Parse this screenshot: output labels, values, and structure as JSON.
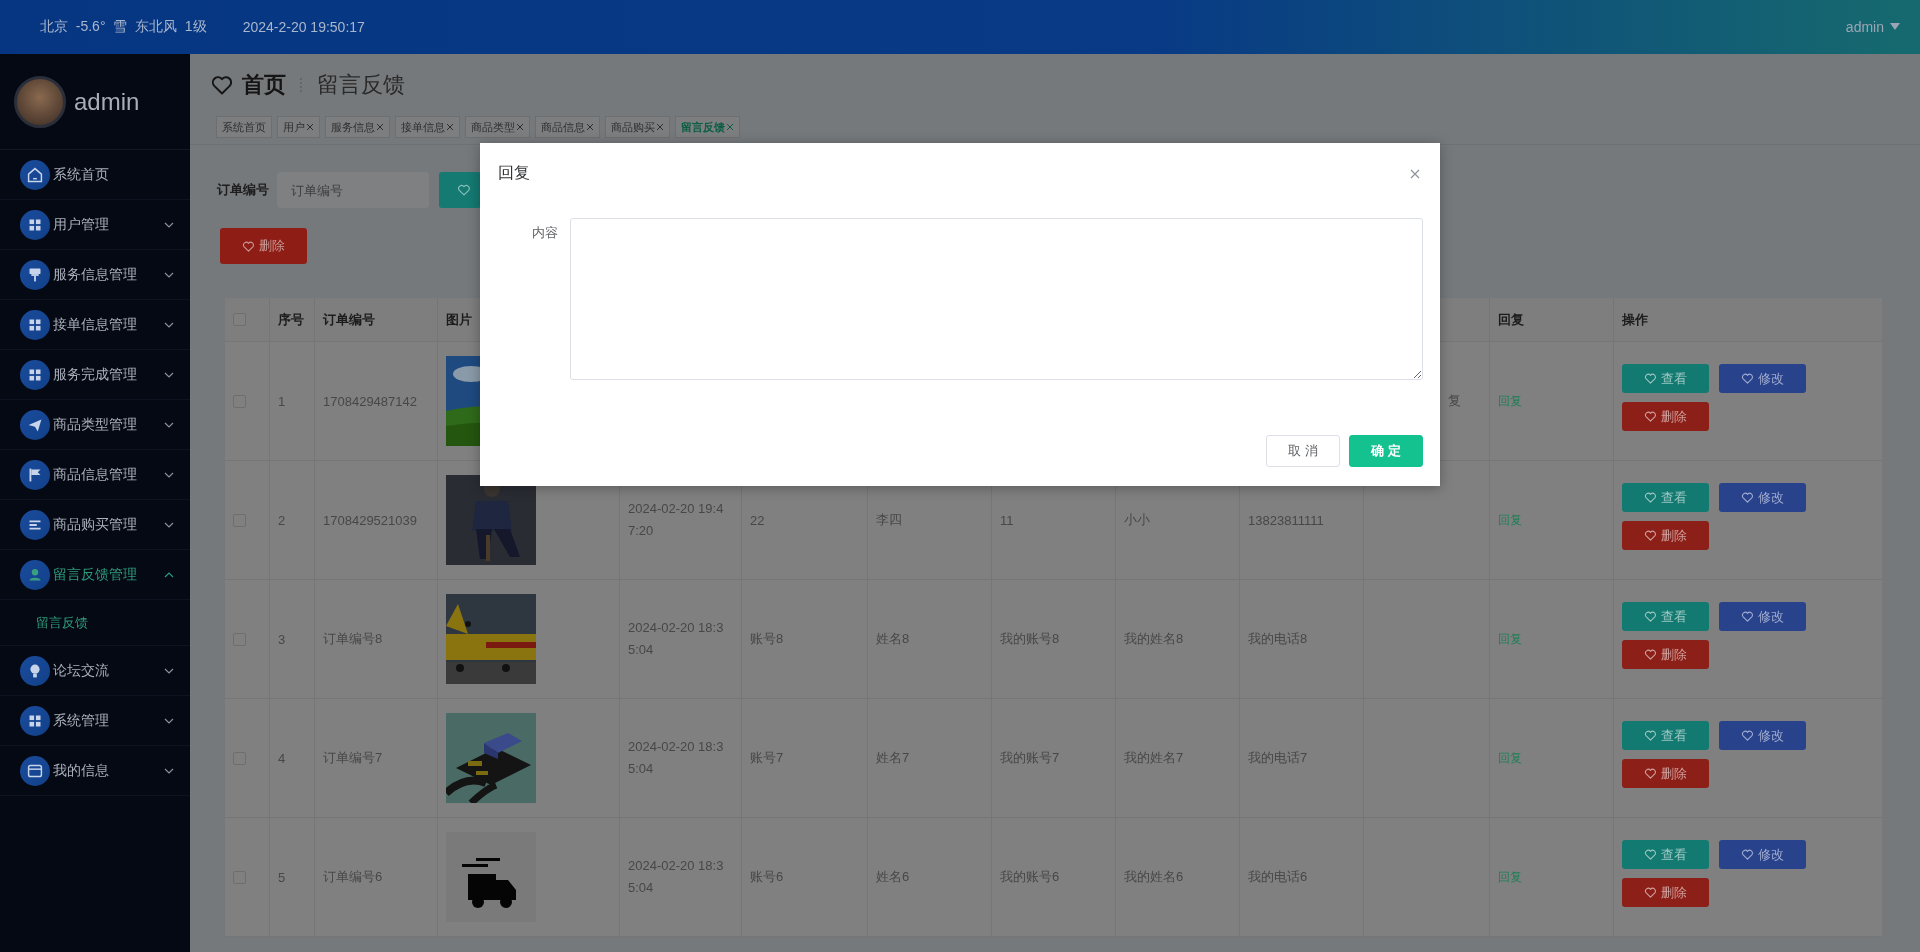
{
  "top_bar": {
    "weather": "北京  -5.6°  雪  东北风  1级",
    "datetime": "2024-2-20 19:50:17",
    "user": "admin"
  },
  "sidebar": {
    "username": "admin",
    "items": [
      {
        "label": "系统首页",
        "kind": "link",
        "selected": false
      },
      {
        "label": "用户管理",
        "kind": "group",
        "selected": false,
        "expanded": false
      },
      {
        "label": "服务信息管理",
        "kind": "group",
        "selected": false,
        "expanded": false
      },
      {
        "label": "接单信息管理",
        "kind": "group",
        "selected": false,
        "expanded": false
      },
      {
        "label": "服务完成管理",
        "kind": "group",
        "selected": false,
        "expanded": false
      },
      {
        "label": "商品类型管理",
        "kind": "group",
        "selected": false,
        "expanded": false
      },
      {
        "label": "商品信息管理",
        "kind": "group",
        "selected": false,
        "expanded": false
      },
      {
        "label": "商品购买管理",
        "kind": "group",
        "selected": false,
        "expanded": false
      },
      {
        "label": "留言反馈管理",
        "kind": "group",
        "selected": true,
        "expanded": true,
        "children": [
          {
            "label": "留言反馈",
            "selected": true
          }
        ]
      },
      {
        "label": "论坛交流",
        "kind": "group",
        "selected": false,
        "expanded": false
      },
      {
        "label": "系统管理",
        "kind": "group",
        "selected": false,
        "expanded": false
      },
      {
        "label": "我的信息",
        "kind": "group",
        "selected": false,
        "expanded": false
      }
    ]
  },
  "page": {
    "breadcrumb": [
      "首页",
      "留言反馈"
    ],
    "tabs": [
      {
        "label": "系统首页",
        "closable": false,
        "selected": false
      },
      {
        "label": "用户",
        "closable": true,
        "selected": false
      },
      {
        "label": "服务信息",
        "closable": true,
        "selected": false
      },
      {
        "label": "接单信息",
        "closable": true,
        "selected": false
      },
      {
        "label": "商品类型",
        "closable": true,
        "selected": false
      },
      {
        "label": "商品信息",
        "closable": true,
        "selected": false
      },
      {
        "label": "商品购买",
        "closable": true,
        "selected": false
      },
      {
        "label": "留言反馈",
        "closable": true,
        "selected": true
      }
    ],
    "search": {
      "label": "订单编号",
      "placeholder": "订单编号"
    },
    "delete_button": "删除"
  },
  "table": {
    "all_checked": false,
    "columns": {
      "index": "序号",
      "order_no": "订单编号",
      "picture": "图片",
      "reply": "回复",
      "actions": "操作"
    },
    "rows": [
      {
        "checked": false,
        "index": "1",
        "order_no": "1708429487142",
        "column_10": "复",
        "reply": "回复",
        "actions": [
          "查看",
          "修改",
          "删除"
        ]
      },
      {
        "checked": false,
        "index": "2",
        "order_no": "1708429521039",
        "time": "2024-02-20 19:47:20",
        "account": "22",
        "name": "李四",
        "my_account": "11",
        "my_name": "小小",
        "my_phone": "13823811111",
        "reply": "回复",
        "actions": [
          "查看",
          "修改",
          "删除"
        ]
      },
      {
        "checked": false,
        "index": "3",
        "order_no": "订单编号8",
        "time": "2024-02-20 18:35:04",
        "account": "账号8",
        "name": "姓名8",
        "my_account": "我的账号8",
        "my_name": "我的姓名8",
        "my_phone": "我的电话8",
        "reply": "回复",
        "actions": [
          "查看",
          "修改",
          "删除"
        ]
      },
      {
        "checked": false,
        "index": "4",
        "order_no": "订单编号7",
        "time": "2024-02-20 18:35:04",
        "account": "账号7",
        "name": "姓名7",
        "my_account": "我的账号7",
        "my_name": "我的姓名7",
        "my_phone": "我的电话7",
        "reply": "回复",
        "actions": [
          "查看",
          "修改",
          "删除"
        ]
      },
      {
        "checked": false,
        "index": "5",
        "order_no": "订单编号6",
        "time": "2024-02-20 18:35:04",
        "account": "账号6",
        "name": "姓名6",
        "my_account": "我的账号6",
        "my_name": "我的姓名6",
        "my_phone": "我的电话6",
        "reply": "回复",
        "actions": [
          "查看",
          "修改",
          "删除"
        ]
      }
    ]
  },
  "dialog": {
    "title": "回复",
    "field_label": "内容",
    "buttons": [
      {
        "label": "取消",
        "kind": "default"
      },
      {
        "label": "确定",
        "kind": "primary"
      }
    ]
  }
}
